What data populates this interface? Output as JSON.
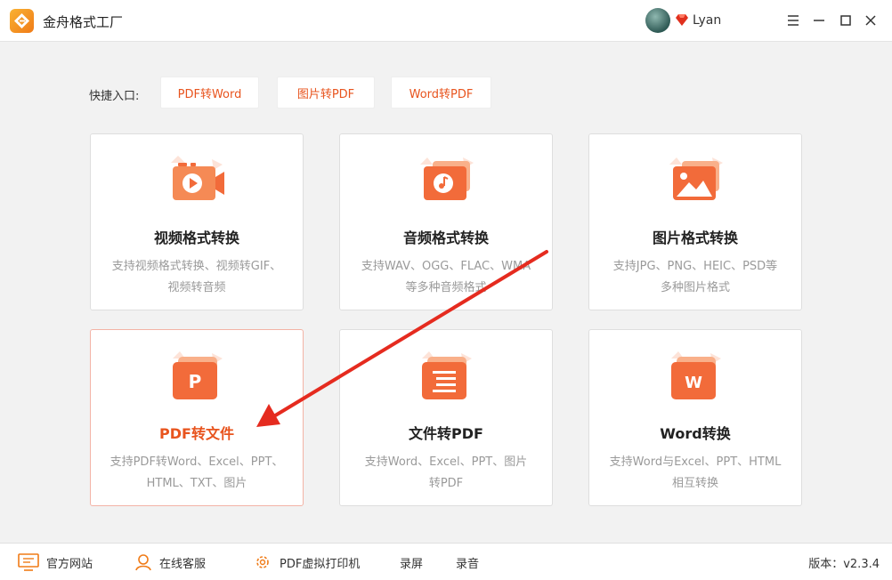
{
  "app": {
    "title": "金舟格式工厂",
    "username": "Lyan"
  },
  "quick": {
    "label": "快捷入口:",
    "buttons": [
      "PDF转Word",
      "图片转PDF",
      "Word转PDF"
    ]
  },
  "cards": [
    {
      "title": "视频格式转换",
      "desc1": "支持视频格式转换、视频转GIF、",
      "desc2": "视频转音频",
      "icon": "video-icon"
    },
    {
      "title": "音频格式转换",
      "desc1": "支持WAV、OGG、FLAC、WMA",
      "desc2": "等多种音频格式",
      "icon": "audio-icon"
    },
    {
      "title": "图片格式转换",
      "desc1": "支持JPG、PNG、HEIC、PSD等",
      "desc2": "多种图片格式",
      "icon": "image-icon"
    },
    {
      "title": "PDF转文件",
      "desc1": "支持PDF转Word、Excel、PPT、",
      "desc2": "HTML、TXT、图片",
      "icon": "pdf-p-icon",
      "active": true
    },
    {
      "title": "文件转PDF",
      "desc1": "支持Word、Excel、PPT、图片",
      "desc2": "转PDF",
      "icon": "document-icon"
    },
    {
      "title": "Word转换",
      "desc1": "支持Word与Excel、PPT、HTML",
      "desc2": "相互转换",
      "icon": "word-w-icon"
    }
  ],
  "footer": {
    "website": "官方网站",
    "service": "在线客服",
    "printer": "PDF虚拟打印机",
    "record_screen": "录屏",
    "record_audio": "录音",
    "version": "版本：v2.3.4"
  },
  "colors": {
    "accent": "#e8541e",
    "icon_orange": "#f26b3a",
    "background": "#f2f2f2"
  }
}
